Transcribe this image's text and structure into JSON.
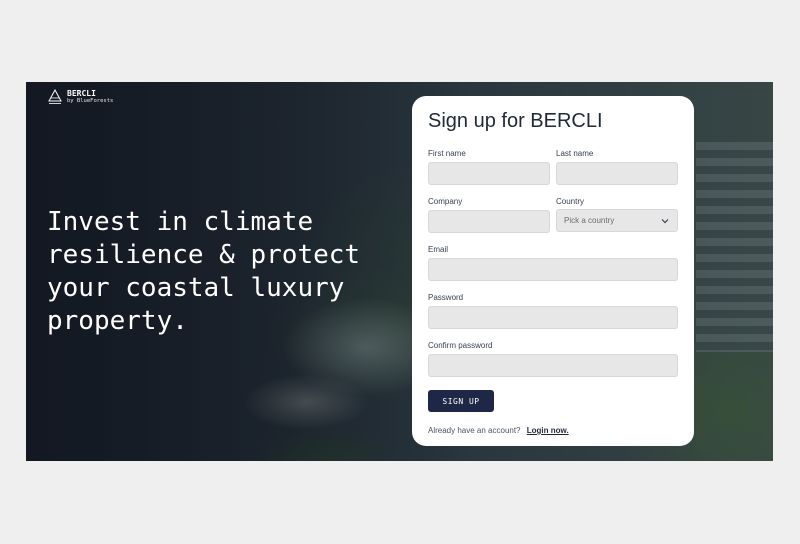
{
  "brand": {
    "name": "BERCLI",
    "subtitle": "by BlueForests"
  },
  "hero": {
    "headline": "Invest in climate resilience & protect your coastal luxury property."
  },
  "signup": {
    "title": "Sign up for BERCLI",
    "first_name": {
      "label": "First name",
      "value": "",
      "placeholder": ""
    },
    "last_name": {
      "label": "Last name",
      "value": "",
      "placeholder": ""
    },
    "company": {
      "label": "Company",
      "value": "",
      "placeholder": ""
    },
    "country": {
      "label": "Country",
      "placeholder": "Pick a country",
      "icon": "chevron-down-icon"
    },
    "email": {
      "label": "Email",
      "value": "",
      "placeholder": ""
    },
    "password": {
      "label": "Password",
      "value": "",
      "placeholder": ""
    },
    "confirm_password": {
      "label": "Confirm password",
      "value": "",
      "placeholder": ""
    },
    "submit_label": "SIGN UP",
    "footer_text": "Already have an account?",
    "login_link": "Login now."
  },
  "colors": {
    "button": "#1e2746",
    "input_bg": "#e7e7e8",
    "page_bg": "#efefef"
  }
}
